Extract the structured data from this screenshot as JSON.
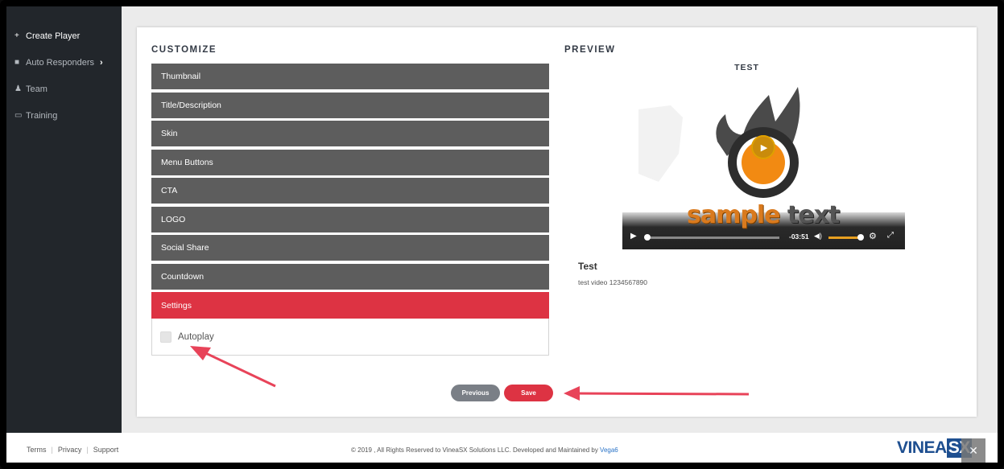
{
  "sidebar": {
    "items": [
      {
        "label": "Create Player",
        "icon": "+"
      },
      {
        "label": "Auto Responders",
        "icon": "■",
        "chevron": "›"
      },
      {
        "label": "Team",
        "icon": "♟"
      },
      {
        "label": "Training",
        "icon": "▭"
      }
    ]
  },
  "customize": {
    "title": "CUSTOMIZE",
    "sections": [
      "Thumbnail",
      "Title/Description",
      "Skin",
      "Menu Buttons",
      "CTA",
      "LOGO",
      "Social Share",
      "Countdown"
    ],
    "open_section": "Settings",
    "autoplay_label": "Autoplay",
    "autoplay_checked": false
  },
  "preview": {
    "title": "PREVIEW",
    "video_title": "TEST",
    "overlay_text_1": "sample",
    "overlay_text_2": "text",
    "time_remaining": "-03:51",
    "info_title": "Test",
    "info_desc": "test video 1234567890"
  },
  "buttons": {
    "previous": "Previous",
    "save": "Save"
  },
  "footer": {
    "links": [
      "Terms",
      "Privacy",
      "Support"
    ],
    "copyright": "© 2019 , All Rights Reserved to VineaSX Solutions LLC. Developed and Maintained by ",
    "developer": "Vega6",
    "brand_1": "VINEA",
    "brand_2": "SX"
  },
  "colors": {
    "accent_red": "#dd3343",
    "accordion_gray": "#5d5d5d",
    "sidebar_dark": "#22262b",
    "brand_blue": "#1e4f90",
    "arrow_red": "#e84359"
  }
}
